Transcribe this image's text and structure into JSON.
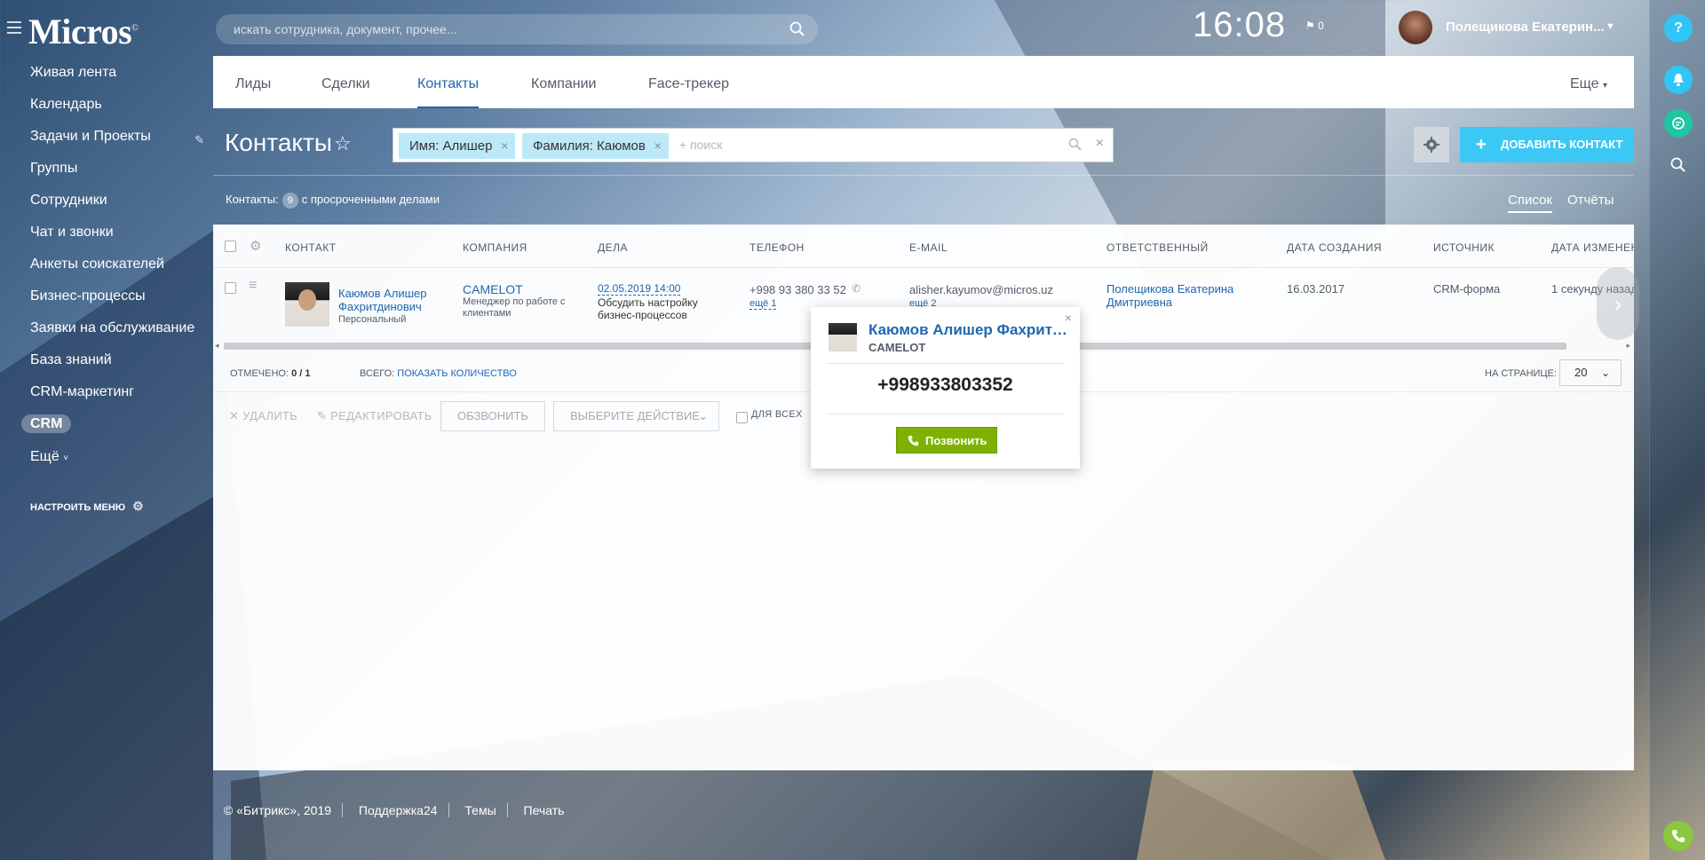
{
  "topbar": {
    "logo": "Micros",
    "logo_mark": "©",
    "search_placeholder": "искать сотрудника, документ, прочее...",
    "clock": "16:08",
    "flag_count": "0",
    "user_name": "Полещикова Екатерин..."
  },
  "sidebar": {
    "items": [
      {
        "label": "Живая лента"
      },
      {
        "label": "Календарь"
      },
      {
        "label": "Задачи и Проекты"
      },
      {
        "label": "Группы"
      },
      {
        "label": "Сотрудники"
      },
      {
        "label": "Чат и звонки"
      },
      {
        "label": "Анкеты соискателей"
      },
      {
        "label": "Бизнес-процессы"
      },
      {
        "label": "Заявки на обслуживание"
      },
      {
        "label": "База знаний"
      },
      {
        "label": "CRM-маркетинг"
      },
      {
        "label": "CRM"
      }
    ],
    "more": "Ещё",
    "configure": "НАСТРОИТЬ МЕНЮ"
  },
  "tabs": [
    "Лиды",
    "Сделки",
    "Контакты",
    "Компании",
    "Face-трекер"
  ],
  "tabs_more": "Еще",
  "page": {
    "title": "Контакты",
    "filter_chips": [
      "Имя: Алишер",
      "Фамилия: Каюмов"
    ],
    "filter_placeholder": "+ поиск",
    "add_button": "ДОБАВИТЬ КОНТАКТ",
    "counter_label": "Контакты:",
    "counter_value": "9",
    "counter_suffix": "с просроченными делами",
    "view_list": "Список",
    "view_reports": "Отчёты"
  },
  "grid": {
    "columns": [
      "КОНТАКТ",
      "КОМПАНИЯ",
      "ДЕЛА",
      "ТЕЛЕФОН",
      "E-MAIL",
      "ОТВЕТСТВЕННЫЙ",
      "ДАТА СОЗДАНИЯ",
      "ИСТОЧНИК",
      "ДАТА ИЗМЕНЕНИ"
    ],
    "row": {
      "contact_name_1": "Каюмов Алишер",
      "contact_name_2": "Фахритдинович",
      "contact_type": "Персональный",
      "company": "CAMELOT",
      "company_role_1": "Менеджер по работе с",
      "company_role_2": "клиентами",
      "deal_date": "02.05.2019 14:00",
      "deal_text_1": "Обсудить настройку",
      "deal_text_2": "бизнес-процессов",
      "phone": "+998 93 380 33 52",
      "phone_more": "ещё 1",
      "email": "alisher.kayumov@micros.uz",
      "email_more": "ещё 2",
      "responsible_1": "Полещикова Екатерина",
      "responsible_2": "Дмитриевна",
      "created": "16.03.2017",
      "source": "CRM-форма",
      "modified": "1 секунду назад"
    },
    "marked_label": "ОТМЕЧЕНО:",
    "marked_value": "0 / 1",
    "total_label": "ВСЕГО:",
    "total_link": "ПОКАЗАТЬ КОЛИЧЕСТВО",
    "per_page_label": "НА СТРАНИЦЕ:",
    "per_page_value": "20",
    "actions": {
      "delete": "УДАЛИТЬ",
      "edit": "РЕДАКТИРОВАТЬ",
      "call": "ОБЗВОНИТЬ",
      "choose": "ВЫБЕРИТЕ ДЕЙСТВИЕ",
      "for_all": "ДЛЯ ВСЕХ"
    }
  },
  "popup": {
    "name": "Каюмов Алишер Фахритдинович",
    "company": "CAMELOT",
    "phone": "+998933803352",
    "call_button": "Позвонить"
  },
  "footer": {
    "copyright": "© «Битрикс», 2019",
    "support": "Поддержка24",
    "themes": "Темы",
    "print": "Печать"
  },
  "colors": {
    "accent": "#2067b0",
    "add_button": "#3bc8f5",
    "call_button": "#7fb200",
    "chip": "#bde8f7"
  }
}
